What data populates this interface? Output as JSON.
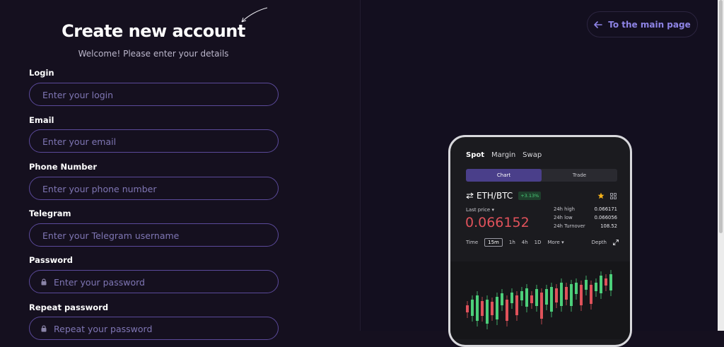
{
  "form": {
    "title": "Create new account",
    "subtitle": "Welcome! Please enter your details",
    "fields": [
      {
        "label": "Login",
        "placeholder": "Enter your login"
      },
      {
        "label": "Email",
        "placeholder": "Enter your email"
      },
      {
        "label": "Phone Number",
        "placeholder": "Enter your phone number"
      },
      {
        "label": "Telegram",
        "placeholder": "Enter your Telegram username"
      },
      {
        "label": "Password",
        "placeholder": "Enter your password"
      },
      {
        "label": "Repeat password",
        "placeholder": "Repeat your password"
      }
    ]
  },
  "nav": {
    "back_label": "To the main page",
    "back_icon": "arrow-left-icon"
  },
  "colors": {
    "accent": "#8e84e6",
    "field_border": "#5b4a9a",
    "background": "#15101f",
    "price_red": "#e0525b",
    "change_green": "#4ccf7a"
  },
  "phone": {
    "tabs": [
      "Spot",
      "Margin",
      "Swap"
    ],
    "segments": [
      "Chart",
      "Trade"
    ],
    "pair": "ETH/BTC",
    "change": "+3.13%",
    "last_price_label": "Last price",
    "price": "0.066152",
    "stats": [
      {
        "label": "24h high",
        "value": "0.066171"
      },
      {
        "label": "24h low",
        "value": "0.066056"
      },
      {
        "label": "24h Turnover",
        "value": "108.52"
      }
    ],
    "timeframes": [
      "Time",
      "15m",
      "1h",
      "4h",
      "1D",
      "More"
    ],
    "depth_label": "Depth"
  }
}
